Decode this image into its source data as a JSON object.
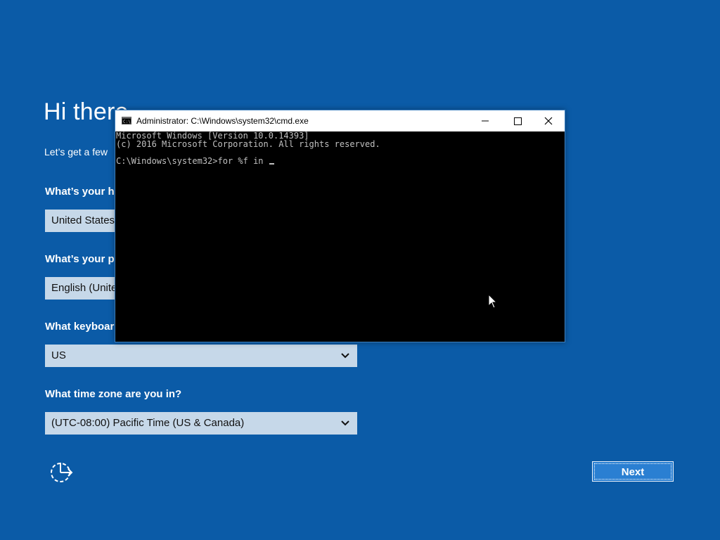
{
  "oobe": {
    "title": "Hi there",
    "subtitle": "Let’s get a few",
    "questions": [
      {
        "label": "What’s your ho",
        "value": "United States"
      },
      {
        "label": "What’s your pr",
        "value": "English (Unite"
      },
      {
        "label": "What keyboard",
        "value": "US"
      },
      {
        "label": "What time zone are you in?",
        "value": "(UTC-08:00) Pacific Time (US & Canada)"
      }
    ],
    "next_label": "Next",
    "back_icon": "ease-of-access-icon"
  },
  "cmd_window": {
    "title": "Administrator: C:\\Windows\\system32\\cmd.exe",
    "lines": [
      "Microsoft Windows [Version 10.0.14393]",
      "(c) 2016 Microsoft Corporation. All rights reserved.",
      "",
      "C:\\Windows\\system32>for %f in "
    ],
    "controls": [
      "minimize-icon",
      "maximize-icon",
      "close-icon"
    ]
  },
  "colors": {
    "background": "#0b5ba7",
    "select_bg": "#c6d8e9",
    "button_bg": "#2a7fd2",
    "console_bg": "#000000",
    "console_text": "#c0c0c0"
  }
}
